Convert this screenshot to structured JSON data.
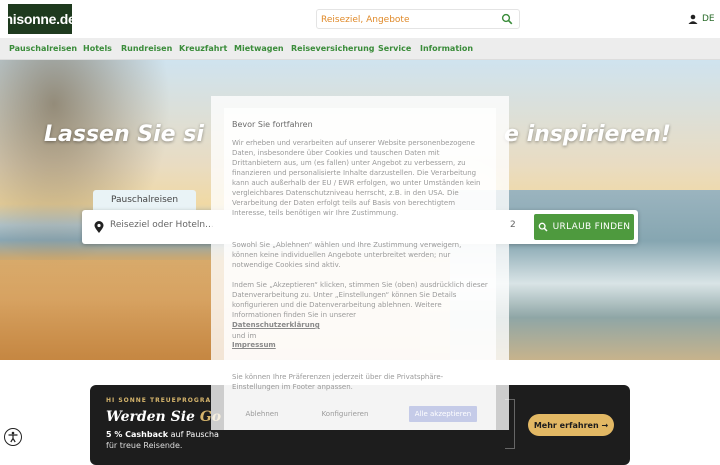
{
  "header": {
    "logo_text": "hisonne.de",
    "search_placeholder": "Reiseziel, Angebote",
    "lang": "DE"
  },
  "nav": {
    "items": [
      "Pauschalreisen",
      "Hotels",
      "Rundreisen",
      "Kreuzfahrt",
      "Mietwagen",
      "Reiseversicherung",
      "Service",
      "Information"
    ],
    "icons": [
      "suitcase-icon",
      "compass-icon",
      "heart-icon"
    ]
  },
  "hero": {
    "title_left": "Lassen Sie si",
    "title_right": "e inspirieren!",
    "tab_label": "Pauschalreisen",
    "destination_placeholder": "Reiseziel oder Hoteln...",
    "travelers_value": "2",
    "find_button": "URLAUB FINDEN"
  },
  "promo": {
    "kicker": "HI SONNE TREUEPROGRA",
    "headline_plain": "Werden Sie ",
    "headline_gold": "Go",
    "line1_bold": "5 % Cashback",
    "line1_rest": " auf Pauscha",
    "line2": "für treue Reisende.",
    "more_button": "Mehr erfahren →"
  },
  "consent": {
    "title": "Bevor Sie fortfahren",
    "para1": "Wir erheben und verarbeiten auf unserer Website personenbezogene Daten, insbesondere über Cookies und tauschen Daten mit Drittanbietern aus, um (es fallen) unter Angebot zu verbessern, zu finanzieren und personalisierte Inhalte darzustellen. Die Verarbeitung kann auch außerhalb der EU / EWR erfolgen, wo unter Umständen kein vergleichbares Datenschutzniveau herrscht, z.B. in den USA. Die Verarbeitung der Daten erfolgt teils auf Basis von berechtigtem Interesse, teils benötigen wir Ihre Zustimmung.",
    "para2": "Sowohl Sie „Ablehnen“ wählen und Ihre Zustimmung verweigern, können keine individuellen Angebote unterbreitet werden; nur notwendige Cookies sind aktiv.",
    "para3": "Indem Sie „Akzeptieren“ klicken, stimmen Sie (oben) ausdrücklich dieser Datenverarbeitung zu. Unter „Einstellungen“ können Sie Details konfigurieren und die Datenverarbeitung ablehnen. Weitere Informationen finden Sie in unserer",
    "privacy_link": "Datenschutzerklärung",
    "and_text": "und im",
    "imprint_link": "Impressum",
    "para4": "Sie können Ihre Präferenzen jederzeit über die Privatsphäre-Einstellungen im Footer anpassen.",
    "btn_reject": "Ablehnen",
    "btn_configure": "Konfigurieren",
    "btn_accept": "Alle akzeptieren"
  },
  "colors": {
    "brand_green": "#3a8c3a",
    "button_green": "#4e9a3e",
    "gold": "#e2b864",
    "accent_orange": "#e08a2a"
  }
}
